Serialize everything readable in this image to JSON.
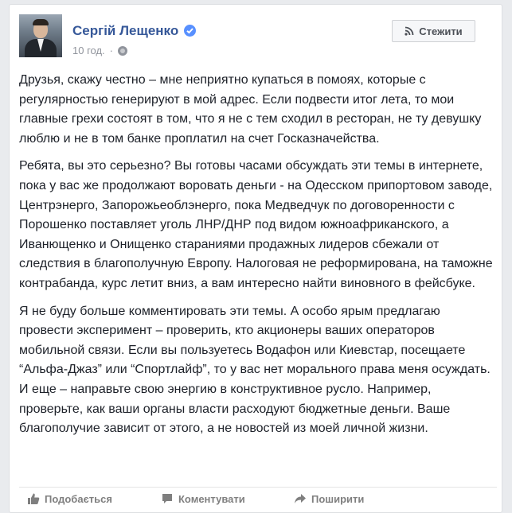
{
  "post": {
    "author": "Сергій Лещенко",
    "timestamp": "10 год.",
    "separator": "·",
    "paragraphs": [
      "Друзья, скажу честно – мне неприятно купаться в помоях, которые с регулярностью генерируют в мой адрес. Если подвести итог лета, то мои главные грехи состоят в том, что я не с тем сходил в ресторан, не ту девушку люблю и не в том банке проплатил на счет Госказначейства.",
      "Ребята, вы это серьезно? Вы готовы часами обсуждать эти темы в интернете, пока у вас же продолжают воровать деньги - на Одесском припортовом заводе, Центрэнерго, Запорожьеоблэнерго, пока Медведчук по договоренности с Порошенко поставляет уголь ЛНР/ДНР под видом южноафриканского, а Иванющенко и Онищенко стараниями продажных лидеров сбежали от следствия в благополучную Европу. Налоговая не реформирована, на таможне контрабанда, курс летит вниз, а вам интересно найти виновного в фейсбуке.",
      "Я не буду больше комментировать эти темы. А особо ярым предлагаю провести эксперимент – проверить, кто акционеры ваших операторов мобильной связи. Если вы пользуетесь Водафон или Киевстар, посещаете “Альфа-Джаз” или “Спортлайф”, то у вас нет морального права меня осуждать. И еще – направьте свою энергию в конструктивное русло. Например, проверьте, как ваши органы власти расходуют бюджетные деньги. Ваше благополучие зависит от этого, а не новостей из моей личной жизни."
    ]
  },
  "follow_button": {
    "label": "Стежити",
    "icon": "rss-icon"
  },
  "actions": {
    "like": "Подобається",
    "comment": "Коментувати",
    "share": "Поширити"
  },
  "colors": {
    "author": "#365899",
    "text": "#1d2129",
    "meta": "#90949c",
    "background": "#e9ebee",
    "verified": "#5890ff"
  }
}
